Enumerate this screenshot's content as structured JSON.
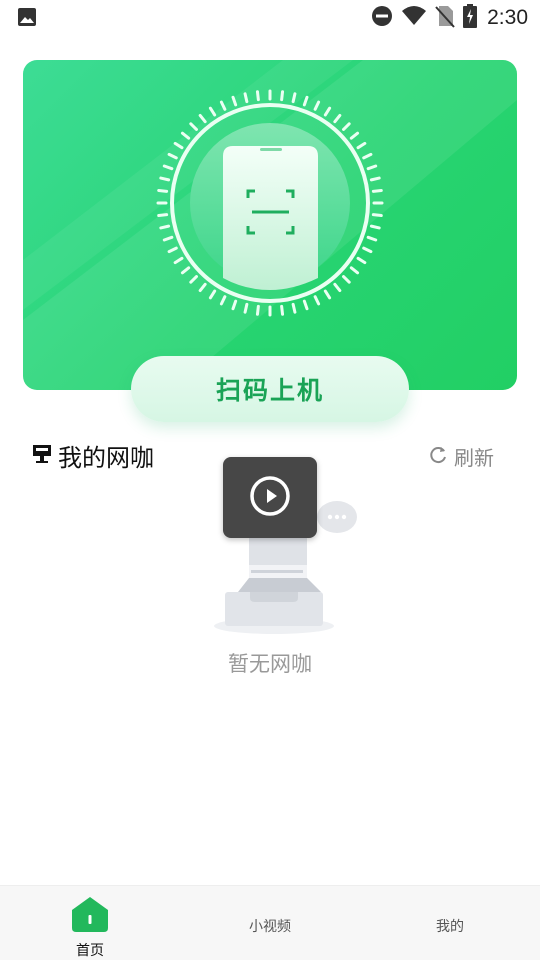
{
  "status_bar": {
    "time": "2:30",
    "icons": [
      "image-icon",
      "do-not-disturb-icon",
      "wifi-icon",
      "no-sim-icon",
      "battery-charging-icon"
    ]
  },
  "hero": {
    "scan_button_label": "扫码上机",
    "accent_color": "#27d472"
  },
  "section": {
    "title": "我的网咖",
    "icon": "pc-icon",
    "refresh_label": "刷新",
    "refresh_icon": "refresh-icon"
  },
  "empty_state": {
    "text": "暂无网咖"
  },
  "floating_video": {
    "icon": "play-icon"
  },
  "bottom_nav": {
    "items": [
      {
        "label": "首页",
        "icon": "home-icon",
        "active": true
      },
      {
        "label": "小视频",
        "icon": "",
        "active": false
      },
      {
        "label": "我的",
        "icon": "",
        "active": false
      }
    ]
  }
}
